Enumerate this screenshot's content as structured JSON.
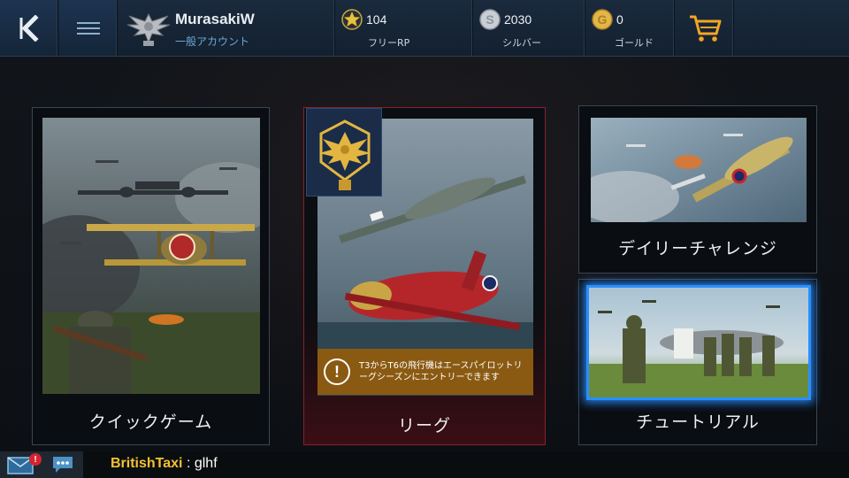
{
  "header": {
    "username": "MurasakiW",
    "account_type": "一般アカウント",
    "free_rp": {
      "value": "104",
      "label": "フリーRP"
    },
    "silver": {
      "value": "2030",
      "label": "シルバー"
    },
    "gold": {
      "value": "0",
      "label": "ゴールド"
    }
  },
  "modes": {
    "quick": {
      "label": "クイックゲーム"
    },
    "league": {
      "label": "リーグ",
      "notice": "T3からT6の飛行機はエースパイロットリーグシーズンにエントリーできます",
      "notice_icon": "!"
    },
    "daily": {
      "label": "デイリーチャレンジ"
    },
    "tutorial": {
      "label": "チュートリアル"
    }
  },
  "chat": {
    "mail_badge": "!",
    "user": "BritishTaxi",
    "separator": " : ",
    "message": "glhf"
  },
  "colors": {
    "topbar": "#142538",
    "accent_blue": "#2a8fff",
    "league_border": "#8b1f2a",
    "notice_bg": "#8a5a12",
    "chat_user": "#f3c233"
  }
}
